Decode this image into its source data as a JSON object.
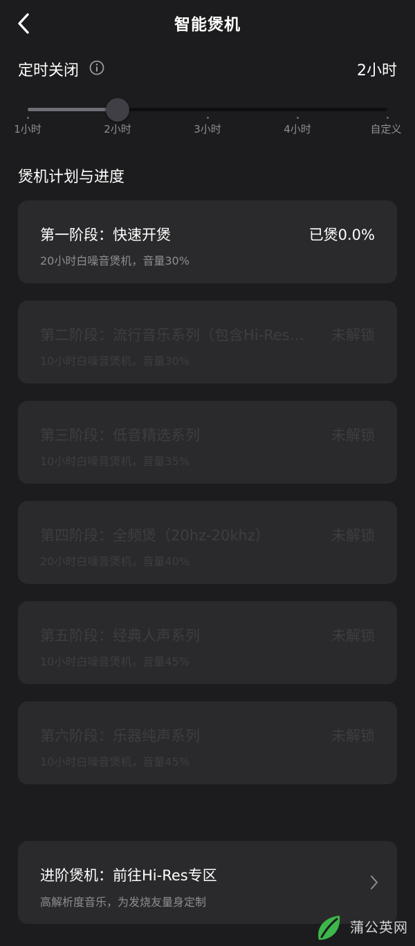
{
  "header": {
    "title": "智能煲机",
    "back_icon": "chevron-left-icon"
  },
  "timer": {
    "label": "定时关闭",
    "info_icon": "info-icon",
    "value": "2小时",
    "options": [
      "1小时",
      "2小时",
      "3小时",
      "4小时",
      "自定义"
    ],
    "selected_index": 1
  },
  "section": {
    "title": "煲机计划与进度"
  },
  "stages": [
    {
      "title": "第一阶段：快速开煲",
      "status": "已煲0.0%",
      "desc": "20小时白噪音煲机，音量30%",
      "locked": false
    },
    {
      "title": "第二阶段：流行音乐系列（包含Hi-Res…",
      "status": "未解锁",
      "desc": "10小时白噪音煲机，音量30%",
      "locked": true
    },
    {
      "title": "第三阶段：低音精选系列",
      "status": "未解锁",
      "desc": "10小时白噪音煲机，音量35%",
      "locked": true
    },
    {
      "title": "第四阶段：全频煲（20hz-20khz）",
      "status": "未解锁",
      "desc": "20小时白噪音煲机，音量40%",
      "locked": true
    },
    {
      "title": "第五阶段：经典人声系列",
      "status": "未解锁",
      "desc": "10小时白噪音煲机，音量45%",
      "locked": true
    },
    {
      "title": "第六阶段：乐器纯声系列",
      "status": "未解锁",
      "desc": "10小时白噪音煲机，音量45%",
      "locked": true
    }
  ],
  "promo": {
    "title": "进阶煲机：前往Hi-Res专区",
    "subtitle": "高解析度音乐，为发烧友量身定制",
    "icon": "chevron-right-icon"
  },
  "watermark": {
    "text": "蒲公英网",
    "icon": "leaf-logo-icon"
  },
  "colors": {
    "background": "#1c1c1e",
    "card": "#2a2a2c",
    "text": "#ffffff",
    "muted": "#8e8e93",
    "locked": "#3e3e42"
  }
}
